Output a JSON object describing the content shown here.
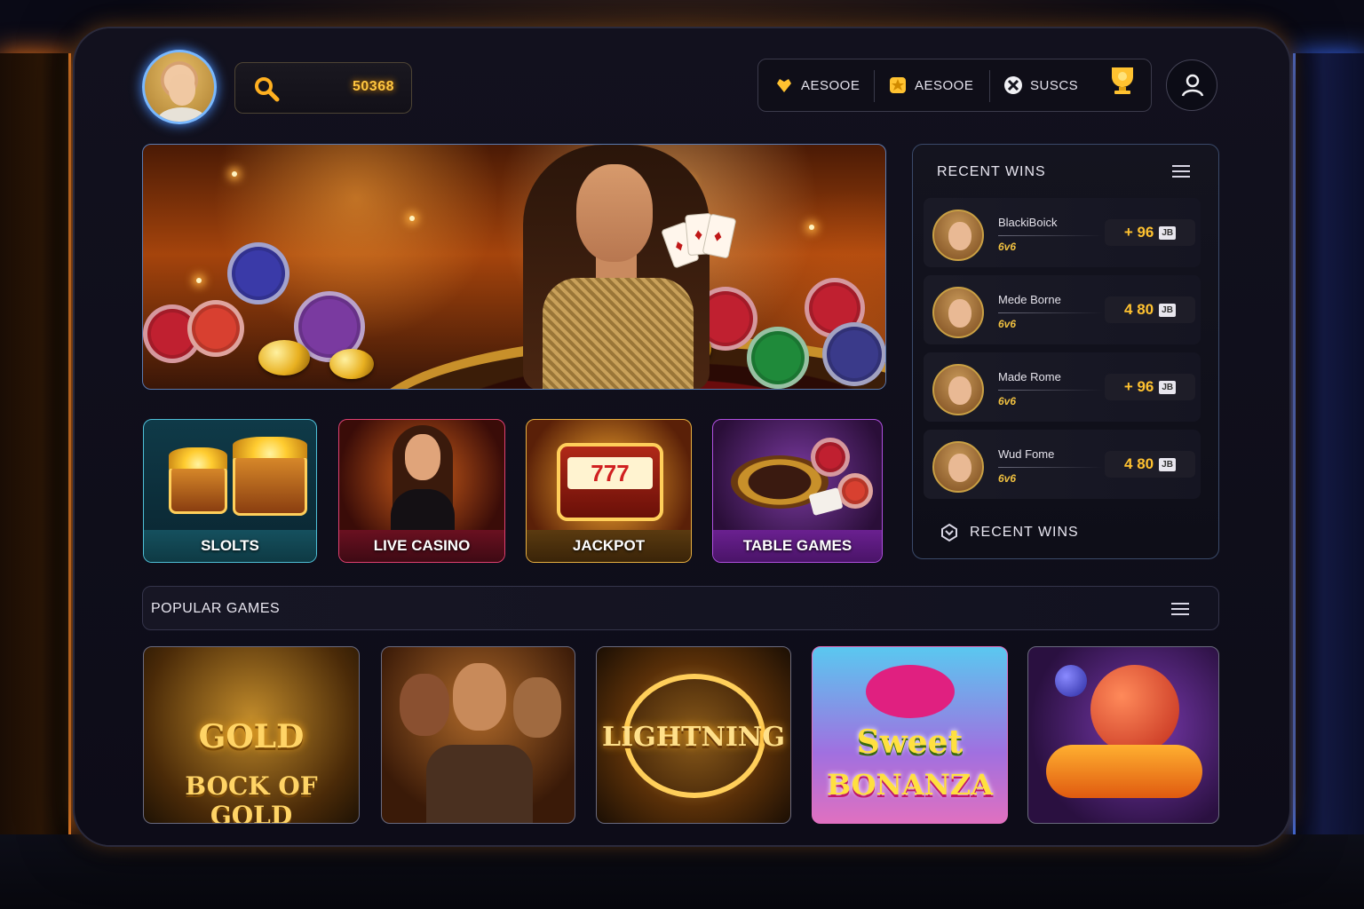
{
  "header": {
    "search_value": "50368",
    "currencies": [
      {
        "icon": "heart-gem-icon",
        "label": "AESOOE"
      },
      {
        "icon": "gold-star-icon",
        "label": "AESOOE"
      },
      {
        "icon": "x-circle-icon",
        "label": "SUSCS"
      }
    ],
    "trophy_icon": "trophy-icon",
    "profile_icon": "user-icon"
  },
  "categories": [
    {
      "label": "SLOLTS",
      "accent": "#4fc0d8"
    },
    {
      "label": "LIVE CASINO",
      "accent": "#e04070"
    },
    {
      "label": "JACKPOT",
      "accent": "#e8b040"
    },
    {
      "label": "TABLE GAMES",
      "accent": "#b050e0"
    }
  ],
  "recent_wins": {
    "title": "RECENT WINS",
    "footer_label": "RECENT WINS",
    "items": [
      {
        "name": "BlackiBoick",
        "sub": "6v6",
        "amount": "+ 96",
        "badge": "JB"
      },
      {
        "name": "Mede Borne",
        "sub": "6v6",
        "amount": "4 80",
        "badge": "JB"
      },
      {
        "name": "Made Rome",
        "sub": "6v6",
        "amount": "+ 96",
        "badge": "JB"
      },
      {
        "name": "Wud Fome",
        "sub": "6v6",
        "amount": "4 80",
        "badge": "JB"
      }
    ]
  },
  "popular": {
    "title": "POPULAR GAMES",
    "games": [
      {
        "line1": "GOLD",
        "line2": "BOCK OF GOLD"
      },
      {
        "line1": "",
        "line2": ""
      },
      {
        "line1": "LIGHTNING",
        "line2": ""
      },
      {
        "line1": "Sweet",
        "line2": "BONANZA"
      },
      {
        "line1": "",
        "line2": ""
      }
    ]
  },
  "colors": {
    "gold": "#ffc230",
    "accent_blue": "#4a7bff",
    "accent_orange": "#ff8a2a"
  }
}
